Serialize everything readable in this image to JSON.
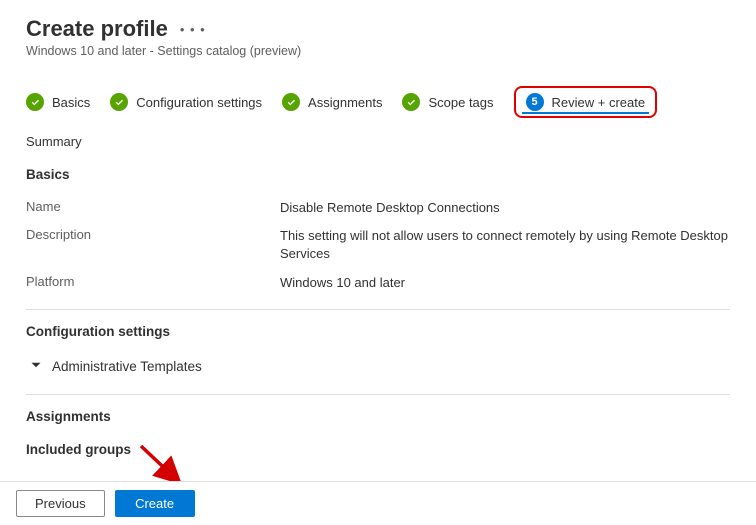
{
  "header": {
    "title": "Create profile",
    "subtitle": "Windows 10 and later - Settings catalog (preview)"
  },
  "steps": {
    "basics": "Basics",
    "config": "Configuration settings",
    "assignments": "Assignments",
    "scope": "Scope tags",
    "review_number": "5",
    "review": "Review + create"
  },
  "summary_label": "Summary",
  "basics": {
    "title": "Basics",
    "name_key": "Name",
    "name_val": "Disable Remote Desktop Connections",
    "desc_key": "Description",
    "desc_val": "This setting will not allow users to connect remotely by using Remote Desktop Services",
    "platform_key": "Platform",
    "platform_val": "Windows 10 and later"
  },
  "config": {
    "title": "Configuration settings",
    "admin_templates": "Administrative Templates"
  },
  "assignments_title": "Assignments",
  "included_groups": "Included groups",
  "buttons": {
    "previous": "Previous",
    "create": "Create"
  }
}
